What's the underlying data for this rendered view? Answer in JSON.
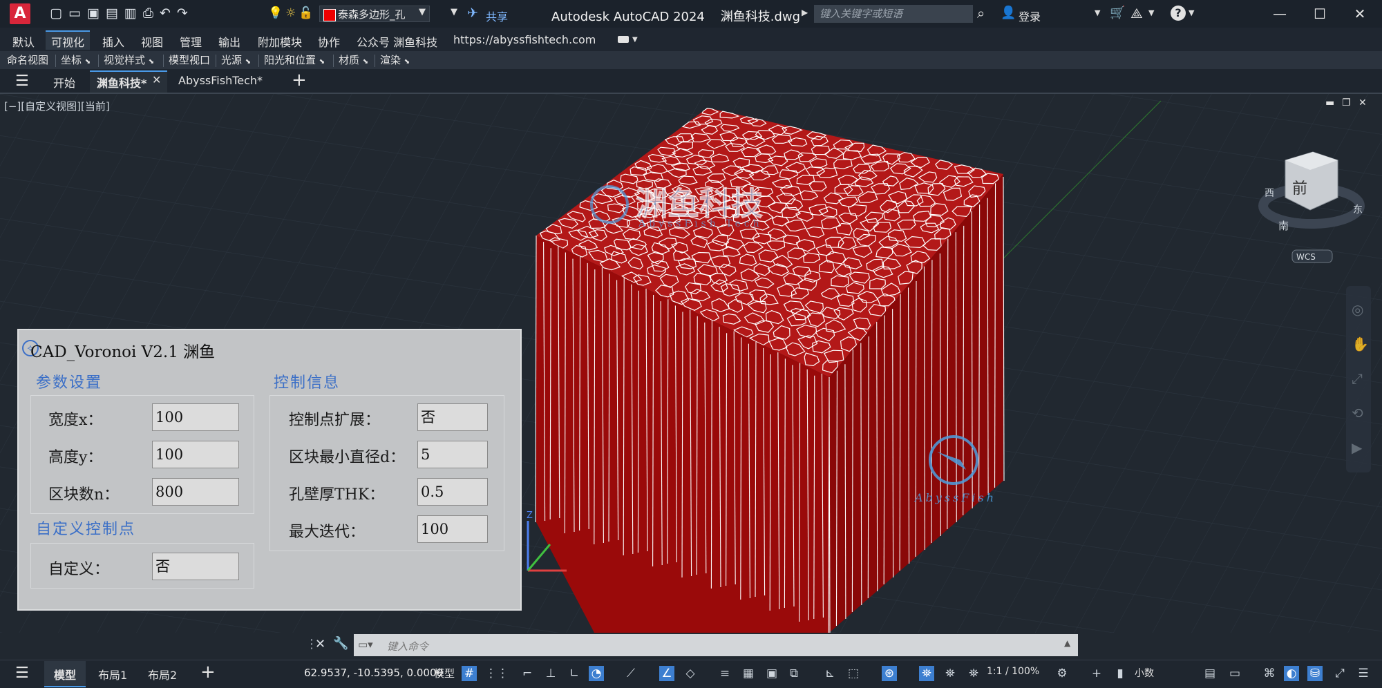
{
  "title_bar": {
    "app_letter": "A",
    "title": "Autodesk AutoCAD 2024    渊鱼科技.dwg",
    "layer_name": "泰森多边形_孔",
    "share": "共享",
    "search_placeholder": "键入关键字或短语",
    "login": "登录"
  },
  "ribbon_tabs": [
    "默认",
    "可视化",
    "插入",
    "视图",
    "管理",
    "输出",
    "附加模块",
    "协作",
    "公众号 渊鱼科技",
    "https://abyssfishtech.com"
  ],
  "ribbon_active": "可视化",
  "panels": [
    "命名视图",
    "坐标",
    "视觉样式",
    "模型视口",
    "光源",
    "阳光和位置",
    "材质",
    "渲染"
  ],
  "doc_tabs": {
    "start": "开始",
    "active": "渊鱼科技*",
    "other": "AbyssFishTech*"
  },
  "viewport": {
    "label": "[−][自定义视图][当前]",
    "viewcube_face": "前",
    "viewcube_dirs": {
      "west": "西",
      "east": "东",
      "south": "南"
    },
    "wcs": "WCS",
    "watermark_cn": "渊鱼科技",
    "watermark_en": "AbyssFish Tech",
    "watermark2": "AbyssFish",
    "model_color": "#a30a0a",
    "edge_color": "#ffffff"
  },
  "dialog": {
    "title": "CAD_Voronoi V2.1 渊鱼",
    "params_title": "参数设置",
    "width_label": "宽度x：",
    "width_value": "100",
    "height_label": "高度y：",
    "height_value": "100",
    "blocks_label": "区块数n：",
    "blocks_value": "800",
    "custom_title": "自定义控制点",
    "custom_label": "自定义：",
    "custom_value": "否",
    "control_title": "控制信息",
    "expand_label": "控制点扩展：",
    "expand_value": "否",
    "mindiam_label": "区块最小直径d：",
    "mindiam_value": "5",
    "wall_label": "孔壁厚THK：",
    "wall_value": "0.5",
    "iter_label": "最大迭代：",
    "iter_value": "100"
  },
  "command": {
    "placeholder": "键入命令"
  },
  "status": {
    "tabs": [
      "模型",
      "布局1",
      "布局2"
    ],
    "coords": "62.9537, -10.5395, 0.0000",
    "model_btn": "模型",
    "scale": "1:1 / 100%",
    "units": "小数"
  }
}
